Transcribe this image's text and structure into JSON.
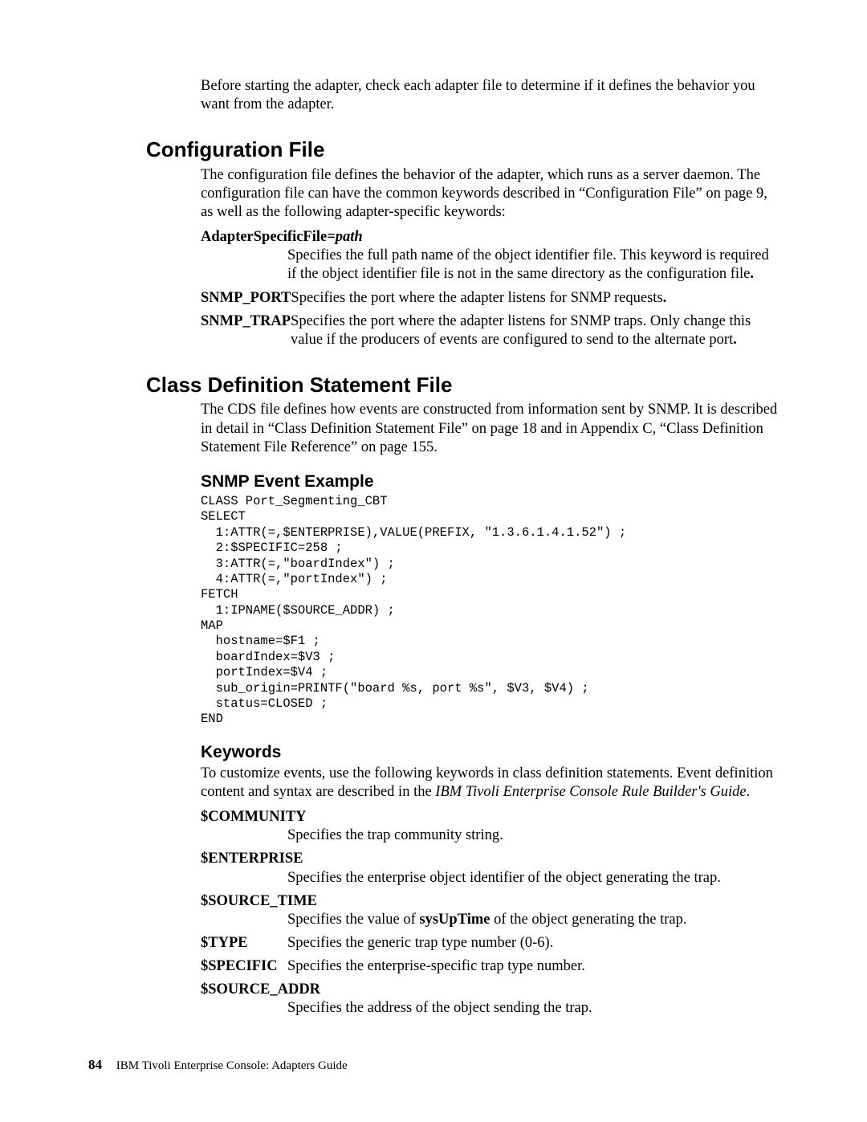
{
  "intro": {
    "p1": "Before starting the adapter, check each adapter file to determine if it defines the behavior you want from the adapter."
  },
  "config": {
    "heading": "Configuration File",
    "p1": "The configuration file defines the behavior of the adapter, which runs as a server daemon. The configuration file can have the common keywords described in “Configuration File” on page 9, as well as the following adapter-specific keywords:",
    "adapter_term_prefix": "AdapterSpecificFile=",
    "adapter_term_var": "path",
    "adapter_def": "Specifies the full path name of the object identifier file. This keyword is required if the object identifier file is not in the same directory as the configuration file",
    "snmp_port_term": "SNMP_PORT",
    "snmp_port_def": "Specifies the port where the adapter listens for SNMP requests",
    "snmp_trap_term": "SNMP_TRAP",
    "snmp_trap_def": "Specifies the port where the adapter listens for SNMP traps. Only change this value if the producers of events are configured to send to the alternate port"
  },
  "cds": {
    "heading": "Class Definition Statement File",
    "p1": "The CDS file defines how events are constructed from information sent by SNMP. It is described in detail in “Class Definition Statement File” on page 18 and in Appendix C, “Class Definition Statement File Reference” on page 155.",
    "example_heading": "SNMP Event Example",
    "code": "CLASS Port_Segmenting_CBT\nSELECT\n  1:ATTR(=,$ENTERPRISE),VALUE(PREFIX, \"1.3.6.1.4.1.52\") ;\n  2:$SPECIFIC=258 ;\n  3:ATTR(=,\"boardIndex\") ;\n  4:ATTR(=,\"portIndex\") ;\nFETCH\n  1:IPNAME($SOURCE_ADDR) ;\nMAP\n  hostname=$F1 ;\n  boardIndex=$V3 ;\n  portIndex=$V4 ;\n  sub_origin=PRINTF(\"board %s, port %s\", $V3, $V4) ;\n  status=CLOSED ;\nEND",
    "keywords_heading": "Keywords",
    "keywords_intro_a": "To customize events, use the following keywords in class definition statements. Event definition content and syntax are described in the ",
    "keywords_intro_em": "IBM Tivoli Enterprise Console Rule Builder's Guide",
    "keywords_intro_b": ".",
    "kw_community_term": "$COMMUNITY",
    "kw_community_def": "Specifies the trap community string.",
    "kw_enterprise_term": "$ENTERPRISE",
    "kw_enterprise_def": "Specifies the enterprise object identifier of the object generating the trap.",
    "kw_source_time_term": "$SOURCE_TIME",
    "kw_source_time_def_a": "Specifies the value of ",
    "kw_source_time_def_b": "sysUpTime",
    "kw_source_time_def_c": " of the object generating the trap.",
    "kw_type_term": "$TYPE",
    "kw_type_def": "Specifies the generic trap type number (0-6).",
    "kw_specific_term": "$SPECIFIC",
    "kw_specific_def": "Specifies the enterprise-specific trap type number.",
    "kw_source_addr_term": "$SOURCE_ADDR",
    "kw_source_addr_def": "Specifies the address of the object sending the trap."
  },
  "footer": {
    "page_number": "84",
    "book_title": "IBM Tivoli Enterprise Console: Adapters Guide"
  }
}
